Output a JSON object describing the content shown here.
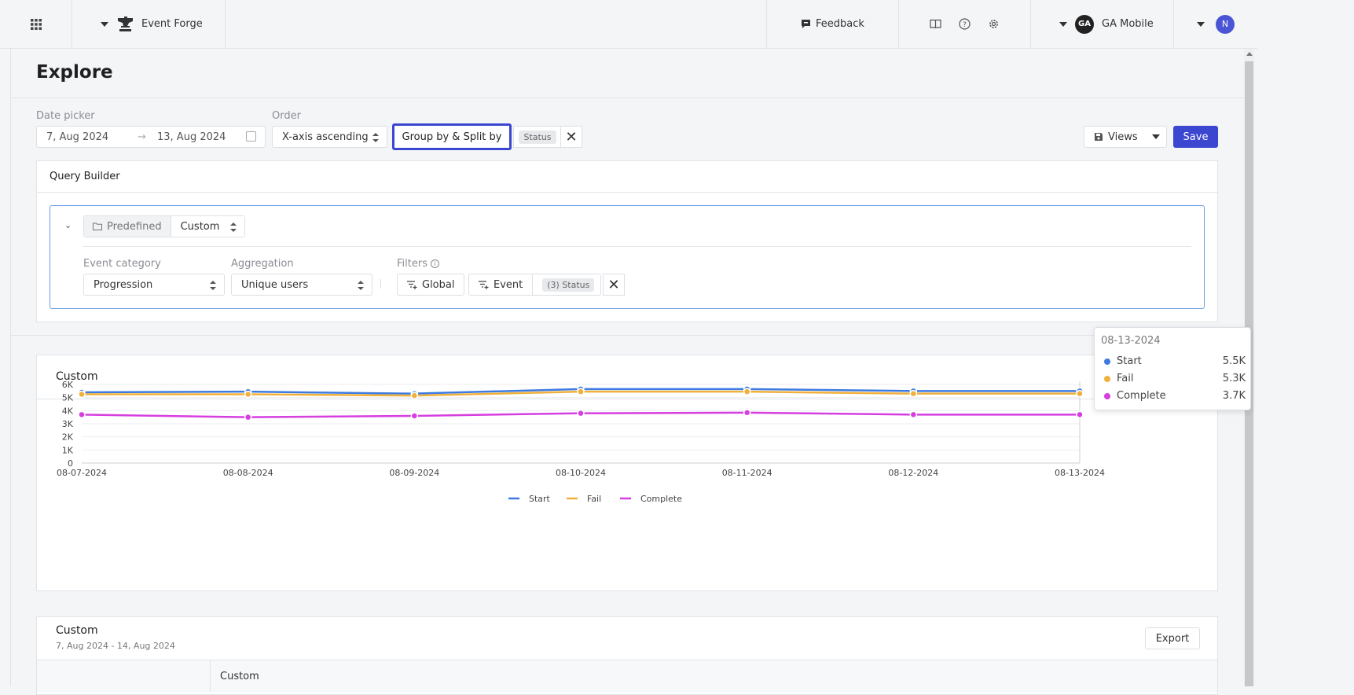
{
  "topbar": {
    "game_name": "Event Forge",
    "feedback_label": "Feedback",
    "studio_name": "GA Mobile",
    "studio_avatar": "GA",
    "user_initial": "N"
  },
  "page": {
    "title": "Explore"
  },
  "filters": {
    "date_label": "Date picker",
    "date_start": "7, Aug 2024",
    "date_end": "13, Aug 2024",
    "order_label": "Order",
    "order_value": "X-axis ascending",
    "groupby_label": "Group by & Split by",
    "groupby_chip": "Status",
    "views_label": "Views",
    "save_label": "Save"
  },
  "query_builder": {
    "title": "Query Builder",
    "mode_predefined": "Predefined",
    "mode_custom": "Custom",
    "event_category_label": "Event category",
    "event_category_value": "Progression",
    "aggregation_label": "Aggregation",
    "aggregation_value": "Unique users",
    "filters_label": "Filters",
    "filter_global": "Global",
    "filter_event": "Event",
    "filter_event_tag": "(3) Status"
  },
  "chart_panel": {
    "title": "Custom"
  },
  "chart_data": {
    "type": "line",
    "categories": [
      "08-07-2024",
      "08-08-2024",
      "08-09-2024",
      "08-10-2024",
      "08-11-2024",
      "08-12-2024",
      "08-13-2024"
    ],
    "ylim": [
      0,
      6000
    ],
    "yticks": [
      "0",
      "1K",
      "2K",
      "3K",
      "4K",
      "5K",
      "6K"
    ],
    "series": [
      {
        "name": "Start",
        "color": "#3d7be0",
        "values": [
          5400,
          5450,
          5300,
          5650,
          5650,
          5500,
          5500
        ]
      },
      {
        "name": "Fail",
        "color": "#f0b03c",
        "values": [
          5250,
          5250,
          5150,
          5450,
          5450,
          5300,
          5300
        ]
      },
      {
        "name": "Complete",
        "color": "#d63ee0",
        "values": [
          3700,
          3500,
          3600,
          3800,
          3850,
          3700,
          3700
        ]
      }
    ],
    "legend_position": "bottom",
    "grid": true
  },
  "tooltip": {
    "date": "08-13-2024",
    "rows": [
      {
        "name": "Start",
        "value": "5.5K",
        "color": "#3d7be0"
      },
      {
        "name": "Fail",
        "value": "5.3K",
        "color": "#f0b03c"
      },
      {
        "name": "Complete",
        "value": "3.7K",
        "color": "#d63ee0"
      }
    ]
  },
  "table_panel": {
    "title": "Custom",
    "subtitle": "7, Aug 2024 - 14, Aug 2024",
    "export_label": "Export",
    "column_header": "Custom"
  }
}
